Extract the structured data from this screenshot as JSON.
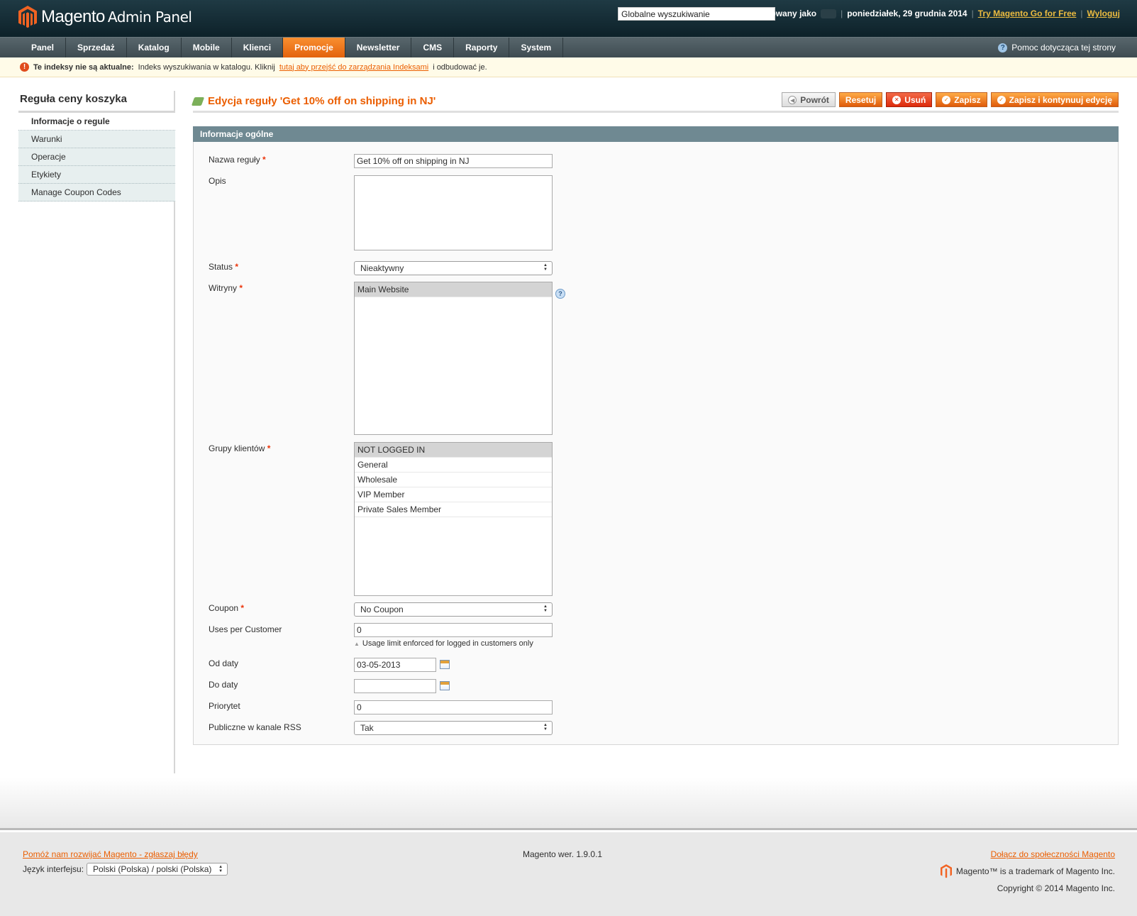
{
  "header": {
    "logo_text": "Magento",
    "logo_sub": "Admin Panel",
    "search_value": "Globalne wyszukiwanie",
    "logged_as": "Zalogowany jako",
    "date": "poniedziałek, 29 grudnia 2014",
    "try_link": "Try Magento Go for Free",
    "logout_link": "Wyloguj"
  },
  "nav": {
    "items": [
      "Panel",
      "Sprzedaż",
      "Katalog",
      "Mobile",
      "Klienci",
      "Promocje",
      "Newsletter",
      "CMS",
      "Raporty",
      "System"
    ],
    "active": "Promocje",
    "help": "Pomoc dotycząca tej strony"
  },
  "notice": {
    "bold": "Te indeksy nie są aktualne:",
    "text": "Indeks wyszukiwania w katalogu. Kliknij",
    "link": "tutaj aby przejść do zarządzania Indeksami",
    "tail": "i odbudować je."
  },
  "sidebar": {
    "title": "Reguła ceny koszyka",
    "items": [
      "Informacje o regule",
      "Warunki",
      "Operacje",
      "Etykiety",
      "Manage Coupon Codes"
    ]
  },
  "page": {
    "title": "Edycja reguły 'Get 10% off on shipping in NJ'",
    "buttons": {
      "back": "Powrót",
      "reset": "Resetuj",
      "delete": "Usuń",
      "save": "Zapisz",
      "save_continue": "Zapisz i kontynuuj edycję"
    }
  },
  "form": {
    "section_title": "Informacje ogólne",
    "labels": {
      "name": "Nazwa reguły",
      "description": "Opis",
      "status": "Status",
      "websites": "Witryny",
      "groups": "Grupy klientów",
      "coupon": "Coupon",
      "uses": "Uses per Customer",
      "from": "Od daty",
      "to": "Do daty",
      "priority": "Priorytet",
      "rss": "Publiczne w kanale RSS"
    },
    "required_mark": "*",
    "values": {
      "name": "Get 10% off on shipping in NJ",
      "description": "",
      "status": "Nieaktywny",
      "coupon": "No Coupon",
      "uses": "0",
      "uses_note": "Usage limit enforced for logged in customers only",
      "from": "03-05-2013",
      "to": "",
      "priority": "0",
      "rss": "Tak"
    },
    "websites": [
      "Main Website"
    ],
    "groups": [
      "NOT LOGGED IN",
      "General",
      "Wholesale",
      "VIP Member",
      "Private Sales Member"
    ]
  },
  "footer": {
    "bug_link": "Pomóż nam rozwijać Magento - zgłaszaj błędy",
    "lang_label": "Język interfejsu:",
    "lang_value": "Polski (Polska) / polski (Polska)",
    "version": "Magento wer. 1.9.0.1",
    "community_link": "Dołącz do społeczności Magento",
    "trademark": "Magento™ is a trademark of Magento Inc.",
    "copyright": "Copyright © 2014 Magento Inc."
  },
  "colors": {
    "accent": "#eb5e00",
    "header_bg": "#0d2129",
    "section_head": "#6f8992"
  }
}
